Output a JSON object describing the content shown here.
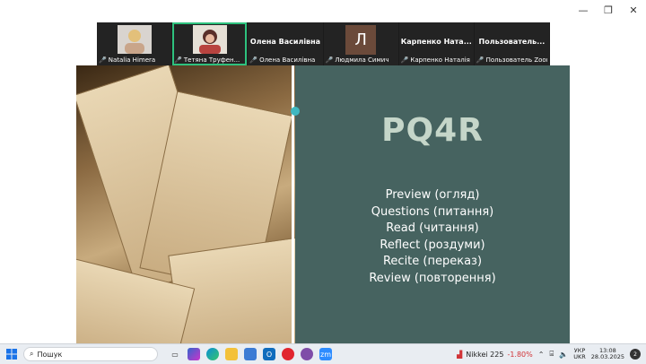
{
  "window": {
    "minimize_glyph": "—",
    "restore_glyph": "❐",
    "close_glyph": "✕"
  },
  "participants": [
    {
      "name": "Natalia Himera",
      "type": "photo",
      "active": false,
      "muted": true
    },
    {
      "name": "Тетяна Труфен...",
      "type": "photo",
      "active": true,
      "muted": true
    },
    {
      "name": "Олена Василівна",
      "display_name": "Олена Василівна",
      "type": "name",
      "muted": true
    },
    {
      "name": "Людмила Симич",
      "avatar_letter": "Л",
      "type": "letter",
      "muted": true
    },
    {
      "name": "Карпенко Наталія",
      "display_name": "Карпенко Ната...",
      "type": "name",
      "muted": true
    },
    {
      "name": "Пользователь Zoom",
      "display_name": "Пользователь...",
      "type": "name",
      "muted": true
    }
  ],
  "slide": {
    "title": "PQ4R",
    "items": [
      "Preview (огляд)",
      "Questions (питання)",
      "Read (читання)",
      "Reflect (роздуми)",
      "Recite (переказ)",
      "Review (повторення)"
    ],
    "colors": {
      "background": "#466360",
      "title": "#c5d6c9",
      "text": "#ffffff",
      "accent": "#3fb8c0"
    }
  },
  "taskbar": {
    "search_placeholder": "Пошук",
    "icons": [
      "task-view-icon",
      "copilot-icon",
      "edge-icon",
      "file-explorer-icon",
      "store-icon",
      "outlook-icon",
      "opera-icon",
      "viber-icon",
      "zoom-icon"
    ],
    "zoom_label": "zm",
    "stock_name": "Nikkei 225",
    "stock_change": "-1.80%",
    "lang_top": "УКР",
    "lang_bottom": "UKR",
    "time": "13:08",
    "date": "28.03.2025",
    "notifications": "2"
  }
}
